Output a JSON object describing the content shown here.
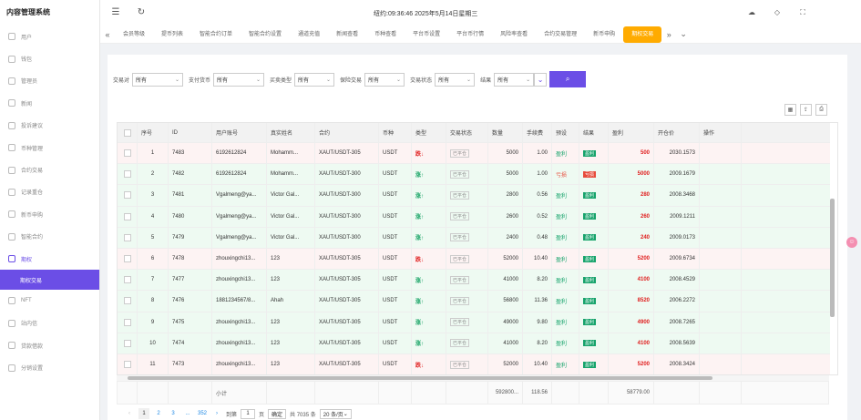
{
  "app_title": "内容管理系统",
  "clock": "纽约:09:36:46 2025年5月14日星期三",
  "sidebar": {
    "items": [
      {
        "label": "用户"
      },
      {
        "label": "钱包"
      },
      {
        "label": "管理员"
      },
      {
        "label": "新闻"
      },
      {
        "label": "投诉建议"
      },
      {
        "label": "币种管理"
      },
      {
        "label": "合约交易"
      },
      {
        "label": "记录重仓"
      },
      {
        "label": "新币申购"
      },
      {
        "label": "智能合约"
      },
      {
        "label": "期权"
      }
    ],
    "active_sub": "期权交易",
    "bottom_items": [
      {
        "label": "NFT"
      },
      {
        "label": "站内信"
      },
      {
        "label": "贷款借款"
      },
      {
        "label": "分销设置"
      }
    ]
  },
  "tabs": [
    "会员等级",
    "提币列表",
    "智能合约订单",
    "智能合约设置",
    "通道充值",
    "新闻查看",
    "币种查看",
    "平台币设置",
    "平台币行情",
    "风险率查看",
    "合约交易管理",
    "新币申购",
    "期权交易"
  ],
  "active_tab": "期权交易",
  "filters": [
    {
      "label": "交易对",
      "value": "所有"
    },
    {
      "label": "支付货币",
      "value": "所有"
    },
    {
      "label": "买卖类型",
      "value": "所有"
    },
    {
      "label": "保险交易",
      "value": "所有"
    },
    {
      "label": "交易状态",
      "value": "所有"
    },
    {
      "label": "结果",
      "value": "所有"
    }
  ],
  "columns": [
    "序号",
    "ID",
    "用户账号",
    "真实姓名",
    "合约",
    "币种",
    "类型",
    "交易状态",
    "数量",
    "手续费",
    "预设",
    "结果",
    "盈利",
    "开仓价",
    "操作"
  ],
  "rows": [
    {
      "no": "1",
      "id": "7483",
      "account": "6192612824",
      "name": "Mohamm...",
      "contract": "XAUT/USDT-305",
      "coin": "USDT",
      "type": "跌↓",
      "dir": "down",
      "status": "已平仓",
      "qty": "5000",
      "fee": "1.00",
      "preset": "盈利",
      "preset_cls": "tg",
      "result": "盈利",
      "result_cls": "win",
      "profit": "500",
      "open": "2030.1573",
      "bg": "#fdf3f3"
    },
    {
      "no": "2",
      "id": "7482",
      "account": "6192612824",
      "name": "Mohamm...",
      "contract": "XAUT/USDT-300",
      "coin": "USDT",
      "type": "涨↑",
      "dir": "up",
      "status": "已平仓",
      "qty": "5000",
      "fee": "1.00",
      "preset": "亏损",
      "preset_cls": "tr",
      "result": "亏损",
      "result_cls": "lose",
      "profit": "5000",
      "open": "2009.1679",
      "bg": "#eefaf2"
    },
    {
      "no": "3",
      "id": "7481",
      "account": "Vgalmeng@ya...",
      "name": "Victor Gal...",
      "contract": "XAUT/USDT-300",
      "coin": "USDT",
      "type": "涨↑",
      "dir": "up",
      "status": "已平仓",
      "qty": "2800",
      "fee": "0.56",
      "preset": "盈利",
      "preset_cls": "tg",
      "result": "盈利",
      "result_cls": "win",
      "profit": "280",
      "open": "2008.3468",
      "bg": "#eefaf2"
    },
    {
      "no": "4",
      "id": "7480",
      "account": "Vgalmeng@ya...",
      "name": "Victor Gal...",
      "contract": "XAUT/USDT-300",
      "coin": "USDT",
      "type": "涨↑",
      "dir": "up",
      "status": "已平仓",
      "qty": "2600",
      "fee": "0.52",
      "preset": "盈利",
      "preset_cls": "tg",
      "result": "盈利",
      "result_cls": "win",
      "profit": "260",
      "open": "2009.1211",
      "bg": "#eefaf2"
    },
    {
      "no": "5",
      "id": "7479",
      "account": "Vgalmeng@ya...",
      "name": "Victor Gal...",
      "contract": "XAUT/USDT-300",
      "coin": "USDT",
      "type": "涨↑",
      "dir": "up",
      "status": "已平仓",
      "qty": "2400",
      "fee": "0.48",
      "preset": "盈利",
      "preset_cls": "tg",
      "result": "盈利",
      "result_cls": "win",
      "profit": "240",
      "open": "2009.0173",
      "bg": "#eefaf2"
    },
    {
      "no": "6",
      "id": "7478",
      "account": "zhouxingchi13...",
      "name": "123",
      "contract": "XAUT/USDT-305",
      "coin": "USDT",
      "type": "跌↓",
      "dir": "down",
      "status": "已平仓",
      "qty": "52000",
      "fee": "10.40",
      "preset": "盈利",
      "preset_cls": "tg",
      "result": "盈利",
      "result_cls": "win",
      "profit": "5200",
      "open": "2009.6734",
      "bg": "#fdf3f3"
    },
    {
      "no": "7",
      "id": "7477",
      "account": "zhouxingchi13...",
      "name": "123",
      "contract": "XAUT/USDT-305",
      "coin": "USDT",
      "type": "涨↑",
      "dir": "up",
      "status": "已平仓",
      "qty": "41000",
      "fee": "8.20",
      "preset": "盈利",
      "preset_cls": "tg",
      "result": "盈利",
      "result_cls": "win",
      "profit": "4100",
      "open": "2008.4529",
      "bg": "#eefaf2"
    },
    {
      "no": "8",
      "id": "7476",
      "account": "1881234567/8...",
      "name": "Ahah",
      "contract": "XAUT/USDT-305",
      "coin": "USDT",
      "type": "涨↑",
      "dir": "up",
      "status": "已平仓",
      "qty": "56800",
      "fee": "11.36",
      "preset": "盈利",
      "preset_cls": "tg",
      "result": "盈利",
      "result_cls": "win",
      "profit": "8520",
      "open": "2006.2272",
      "bg": "#eefaf2"
    },
    {
      "no": "9",
      "id": "7475",
      "account": "zhouxingchi13...",
      "name": "123",
      "contract": "XAUT/USDT-305",
      "coin": "USDT",
      "type": "涨↑",
      "dir": "up",
      "status": "已平仓",
      "qty": "49000",
      "fee": "9.80",
      "preset": "盈利",
      "preset_cls": "tg",
      "result": "盈利",
      "result_cls": "win",
      "profit": "4900",
      "open": "2008.7265",
      "bg": "#eefaf2"
    },
    {
      "no": "10",
      "id": "7474",
      "account": "zhouxingchi13...",
      "name": "123",
      "contract": "XAUT/USDT-305",
      "coin": "USDT",
      "type": "涨↑",
      "dir": "up",
      "status": "已平仓",
      "qty": "41000",
      "fee": "8.20",
      "preset": "盈利",
      "preset_cls": "tg",
      "result": "盈利",
      "result_cls": "win",
      "profit": "4100",
      "open": "2008.5639",
      "bg": "#eefaf2"
    },
    {
      "no": "11",
      "id": "7473",
      "account": "zhouxingchi13...",
      "name": "123",
      "contract": "XAUT/USDT-305",
      "coin": "USDT",
      "type": "跌↓",
      "dir": "down",
      "status": "已平仓",
      "qty": "52000",
      "fee": "10.40",
      "preset": "盈利",
      "preset_cls": "tg",
      "result": "盈利",
      "result_cls": "win",
      "profit": "5200",
      "open": "2008.3424",
      "bg": "#fdf3f3"
    }
  ],
  "summary": {
    "label": "小计",
    "qty": "592800...",
    "fee": "118.56",
    "profit": "58779.00"
  },
  "pager": {
    "pages": [
      "1",
      "2",
      "3",
      "...",
      "352"
    ],
    "goto_label": "到第",
    "goto_value": "1",
    "page_unit": "页",
    "confirm": "确定",
    "total": "共 7035 条",
    "page_size": "20 条/页"
  }
}
